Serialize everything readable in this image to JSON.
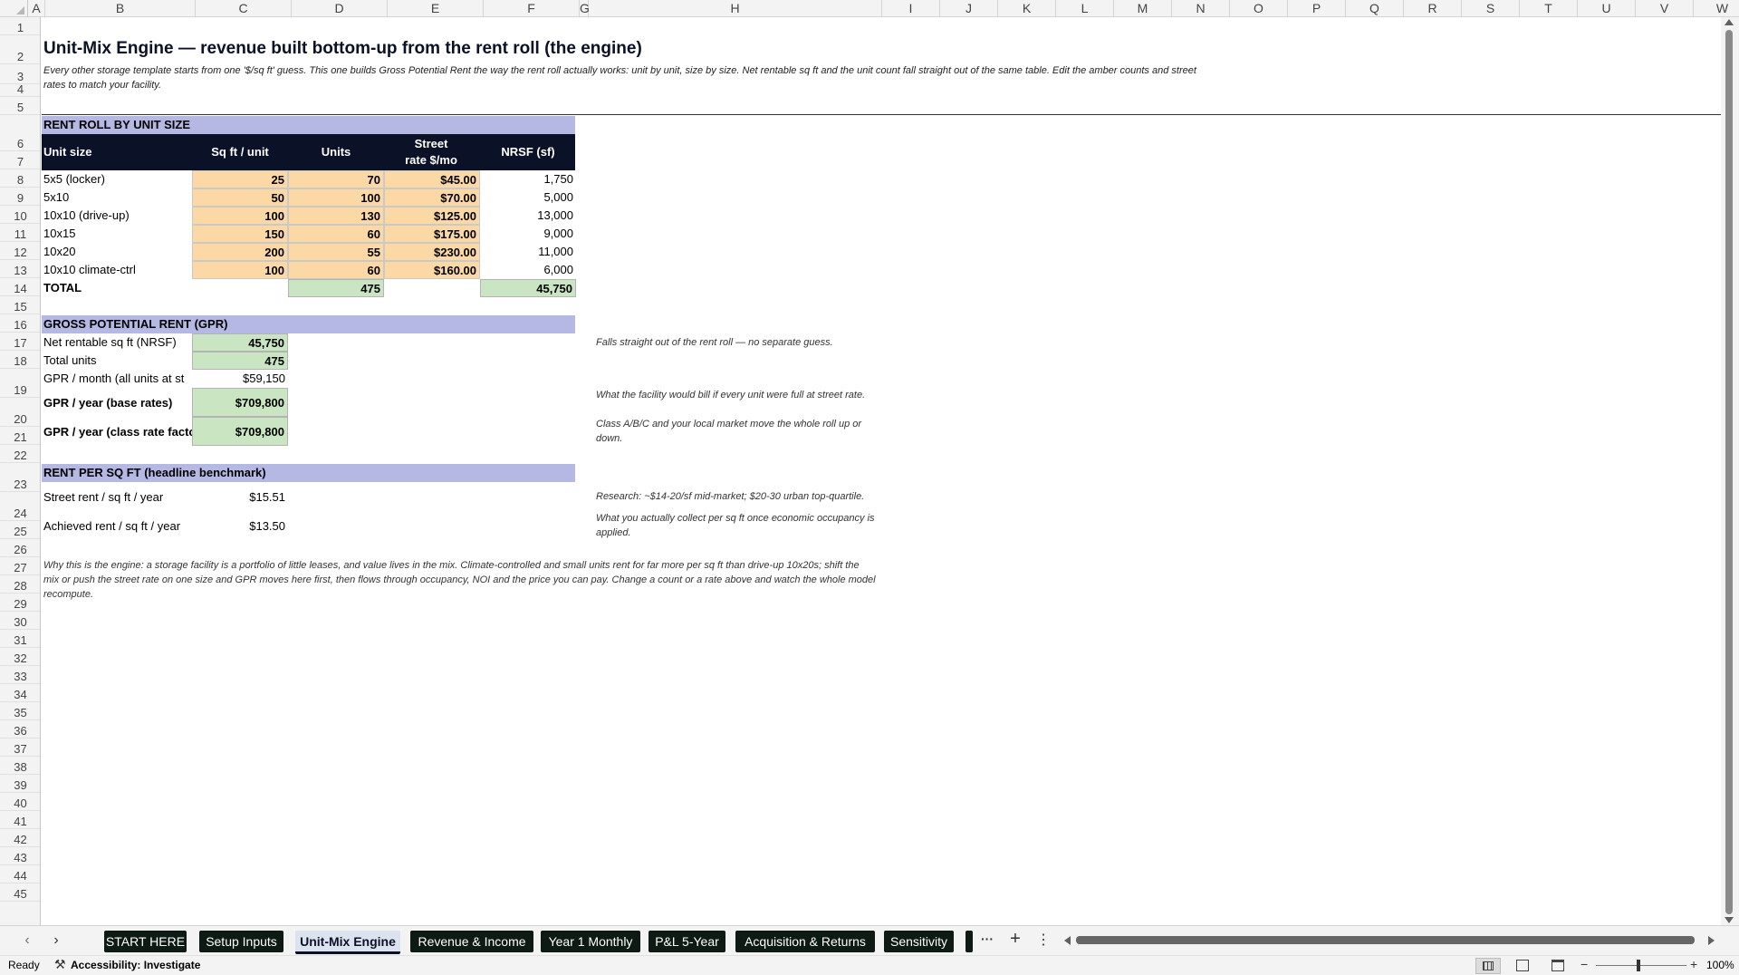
{
  "columns": [
    "A",
    "B",
    "C",
    "D",
    "E",
    "F",
    "G",
    "H",
    "I",
    "J",
    "K",
    "L",
    "M",
    "N",
    "O",
    "P",
    "Q",
    "R",
    "S",
    "T",
    "U",
    "V",
    "W"
  ],
  "rows": [
    "1",
    "2",
    "3",
    "4",
    "5",
    "6",
    "7",
    "8",
    "9",
    "10",
    "11",
    "12",
    "13",
    "14",
    "15",
    "16",
    "17",
    "18",
    "19",
    "20",
    "21",
    "22",
    "23",
    "24",
    "25",
    "26",
    "27",
    "28",
    "29",
    "30",
    "31",
    "32",
    "33",
    "34",
    "35",
    "36",
    "37",
    "38",
    "39",
    "40",
    "41",
    "42",
    "43",
    "44",
    "45"
  ],
  "title": "Unit-Mix Engine — revenue built bottom-up from the rent roll (the engine)",
  "subtitle": "Every other storage template starts from one '$/sq ft' guess. This one builds Gross Potential Rent the way the rent roll actually works: unit by unit, size by size. Net rentable sq ft and the unit count fall straight out of the same table. Edit the amber counts and street rates to match your facility.",
  "rent_roll": {
    "section_title": "RENT ROLL BY UNIT SIZE",
    "headers": [
      "Unit size",
      "Sq ft / unit",
      "Units",
      "Street rate $/mo",
      "NRSF (sf)"
    ],
    "rows": [
      {
        "size": "5x5 (locker)",
        "sqft": "25",
        "units": "70",
        "rate": "$45.00",
        "nrsf": "1,750"
      },
      {
        "size": "5x10",
        "sqft": "50",
        "units": "100",
        "rate": "$70.00",
        "nrsf": "5,000"
      },
      {
        "size": "10x10 (drive-up)",
        "sqft": "100",
        "units": "130",
        "rate": "$125.00",
        "nrsf": "13,000"
      },
      {
        "size": "10x15",
        "sqft": "150",
        "units": "60",
        "rate": "$175.00",
        "nrsf": "9,000"
      },
      {
        "size": "10x20",
        "sqft": "200",
        "units": "55",
        "rate": "$230.00",
        "nrsf": "11,000"
      },
      {
        "size": "10x10 climate-ctrl",
        "sqft": "100",
        "units": "60",
        "rate": "$160.00",
        "nrsf": "6,000"
      }
    ],
    "total_label": "TOTAL",
    "total_units": "475",
    "total_nrsf": "45,750"
  },
  "gpr": {
    "section_title": "GROSS POTENTIAL RENT (GPR)",
    "nrsf_label": "Net rentable sq ft (NRSF)",
    "nrsf_value": "45,750",
    "nrsf_note": "Falls straight out of the rent roll — no separate guess.",
    "units_label": "Total units",
    "units_value": "475",
    "month_label": "GPR / month (all units at st",
    "month_value": "$59,150",
    "year_base_label": "GPR / year (base rates)",
    "year_base_value": "$709,800",
    "year_base_note": "What the facility would bill if every unit were full at street rate.",
    "year_class_label": "GPR / year (class rate facto",
    "year_class_value": "$709,800",
    "year_class_note": "Class A/B/C and your local market move the whole roll up or down."
  },
  "rent_psf": {
    "section_title": "RENT PER SQ FT (headline benchmark)",
    "street_label": "Street rent / sq ft / year",
    "street_value": "$15.51",
    "street_note": "Research: ~$14-20/sf mid-market; $20-30 urban top-quartile.",
    "achieved_label": "Achieved rent / sq ft / year",
    "achieved_value": "$13.50",
    "achieved_note": "What you actually collect per sq ft once economic occupancy is applied."
  },
  "footnote": "Why this is the engine: a storage facility is a portfolio of little leases, and value lives in the mix. Climate-controlled and small units rent for far more per sq ft than drive-up 10x20s; shift the mix or push the street rate on one size and GPR moves here first, then flows through occupancy, NOI and the price you can pay. Change a count or a rate above and watch the whole model recompute.",
  "tabs": [
    "START HERE",
    "Setup Inputs",
    "Unit-Mix Engine",
    "Revenue & Income",
    "Year 1 Monthly",
    "P&L 5-Year",
    "Acquisition & Returns",
    "Sensitivity"
  ],
  "active_tab": "Unit-Mix Engine",
  "tab_more": "···",
  "tab_add": "+",
  "tab_options": "⋮",
  "status_ready": "Ready",
  "status_accessibility": "Accessibility: Investigate",
  "zoom": "100%",
  "colors": {
    "amber": "#fcd8a4",
    "green": "#c9e5c1",
    "band": "#b4b8e3",
    "header": "#0b1126",
    "tab": "#0e1a14"
  }
}
